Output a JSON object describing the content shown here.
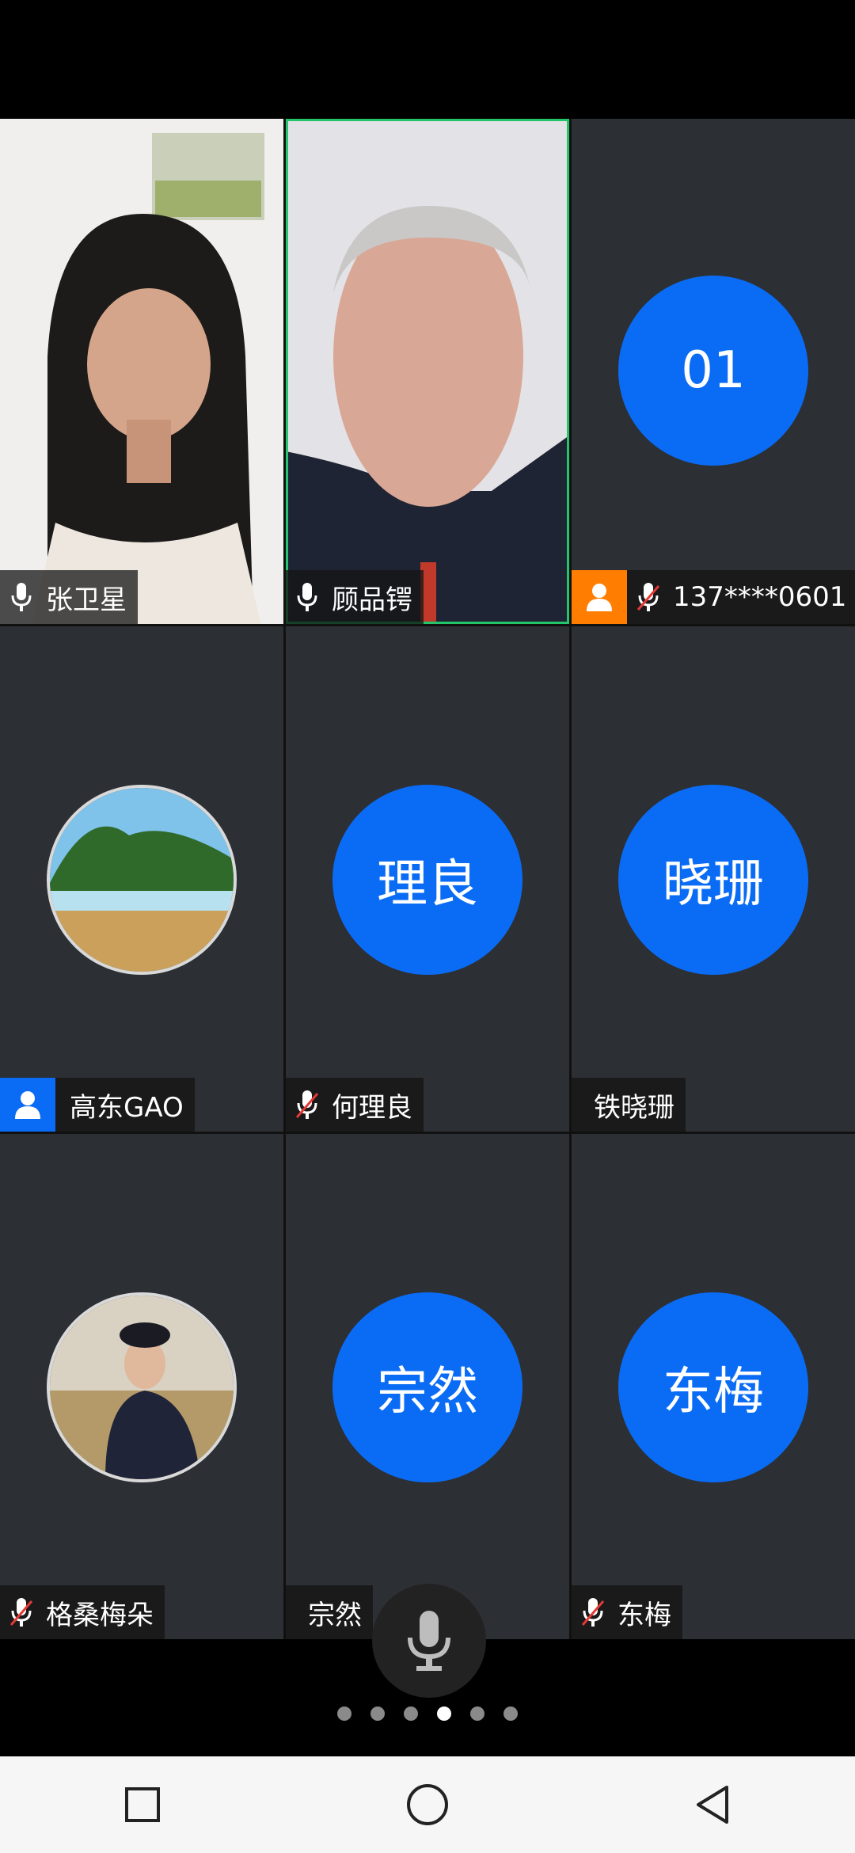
{
  "participants": [
    {
      "name": "张卫星",
      "mic": "on",
      "type": "video"
    },
    {
      "name": "顾品锷",
      "mic": "on",
      "type": "video",
      "active": true
    },
    {
      "name": "137****0601",
      "mic": "muted",
      "type": "initials",
      "initials": "01",
      "badge": "orange"
    },
    {
      "name": "高东GAO",
      "mic": "none",
      "type": "photo",
      "badge": "blue"
    },
    {
      "name": "何理良",
      "mic": "muted",
      "type": "initials",
      "initials": "理良"
    },
    {
      "name": "铁晓珊",
      "mic": "none",
      "type": "initials",
      "initials": "晓珊"
    },
    {
      "name": "格桑梅朵",
      "mic": "muted",
      "type": "photo"
    },
    {
      "name": "宗然",
      "mic": "none",
      "type": "initials",
      "initials": "宗然"
    },
    {
      "name": "东梅",
      "mic": "muted",
      "type": "initials",
      "initials": "东梅"
    }
  ],
  "pagination": {
    "total": 6,
    "current": 4
  },
  "colors": {
    "accent": "#0a6cf5",
    "active_border": "#23c46a",
    "badge_orange": "#ff7d00"
  },
  "icons": {
    "mic": "microphone-icon",
    "mic_muted": "microphone-muted-icon",
    "person": "person-icon"
  },
  "nav": [
    "recents-button",
    "home-button",
    "back-button"
  ]
}
